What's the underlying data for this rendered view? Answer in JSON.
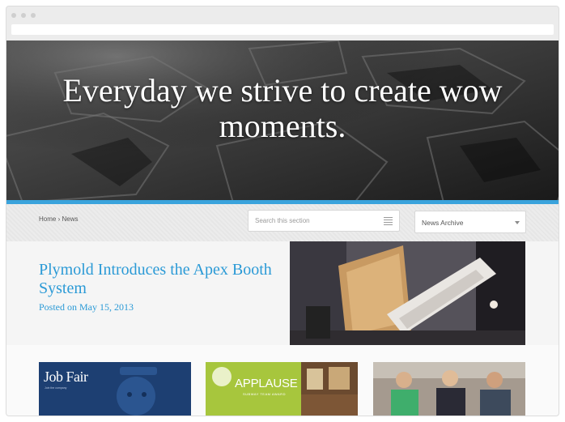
{
  "hero": {
    "headline": "Everyday we strive to create wow moments."
  },
  "breadcrumb": {
    "home": "Home",
    "separator": "›",
    "current": "News"
  },
  "search": {
    "placeholder": "Search this section"
  },
  "archive": {
    "selected": "News Archive"
  },
  "feature": {
    "title": "Plymold Introduces the Apex Booth System",
    "date": "Posted on May 15, 2013"
  },
  "cards": [
    {
      "title": "Job Fair",
      "subtitle": "Join the company"
    },
    {
      "title": "APPLAUSE",
      "subtitle": "SUBWAY TEAM AWARD"
    },
    {
      "title": ""
    }
  ],
  "colors": {
    "accent": "#3aa3dc",
    "link": "#2b9ad6",
    "hero_bg": "#222222"
  },
  "icons": [
    "menu-lines-icon",
    "caret-down-icon",
    "hand-icon"
  ]
}
